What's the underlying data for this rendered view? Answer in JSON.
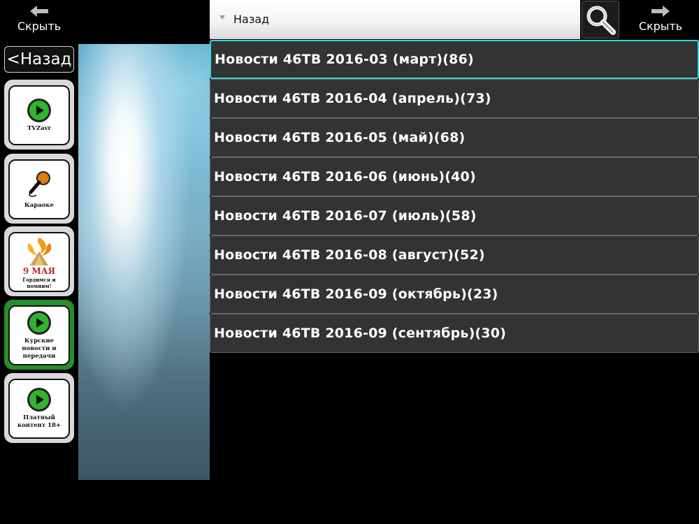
{
  "left_panel": {
    "hide_label": "Скрыть",
    "back_label": "<Назад",
    "tiles": [
      {
        "caption": "TVZavr",
        "icon": "play-icon"
      },
      {
        "caption": "Караоке",
        "icon": "microphone-icon"
      },
      {
        "caption_big": "9 МАЯ",
        "caption": "Гордимся и помним!",
        "icon": "eternal-flame-icon"
      },
      {
        "caption": "Курские новости и передачи",
        "icon": "play-icon",
        "selected": true
      },
      {
        "caption": "Платный контент 18+",
        "icon": "play-icon"
      }
    ]
  },
  "top_bar": {
    "back_label": "Назад",
    "hide_label": "Скрыть"
  },
  "list": {
    "items": [
      "Новости 46ТВ 2016-03 (март)(86)",
      "Новости 46ТВ 2016-04 (апрель)(73)",
      "Новости 46ТВ 2016-05 (май)(68)",
      "Новости 46ТВ 2016-06 (июнь)(40)",
      "Новости 46ТВ 2016-07 (июль)(58)",
      "Новости 46ТВ 2016-08 (август)(52)",
      "Новости 46ТВ 2016-09 (октябрь)(23)",
      "Новости 46ТВ 2016-09 (сентябрь)(30)"
    ],
    "active_index": 0
  },
  "colors": {
    "accent_border": "#3ad6dc",
    "selected_tile": "#2a8d2a",
    "row_bg": "#333333"
  }
}
